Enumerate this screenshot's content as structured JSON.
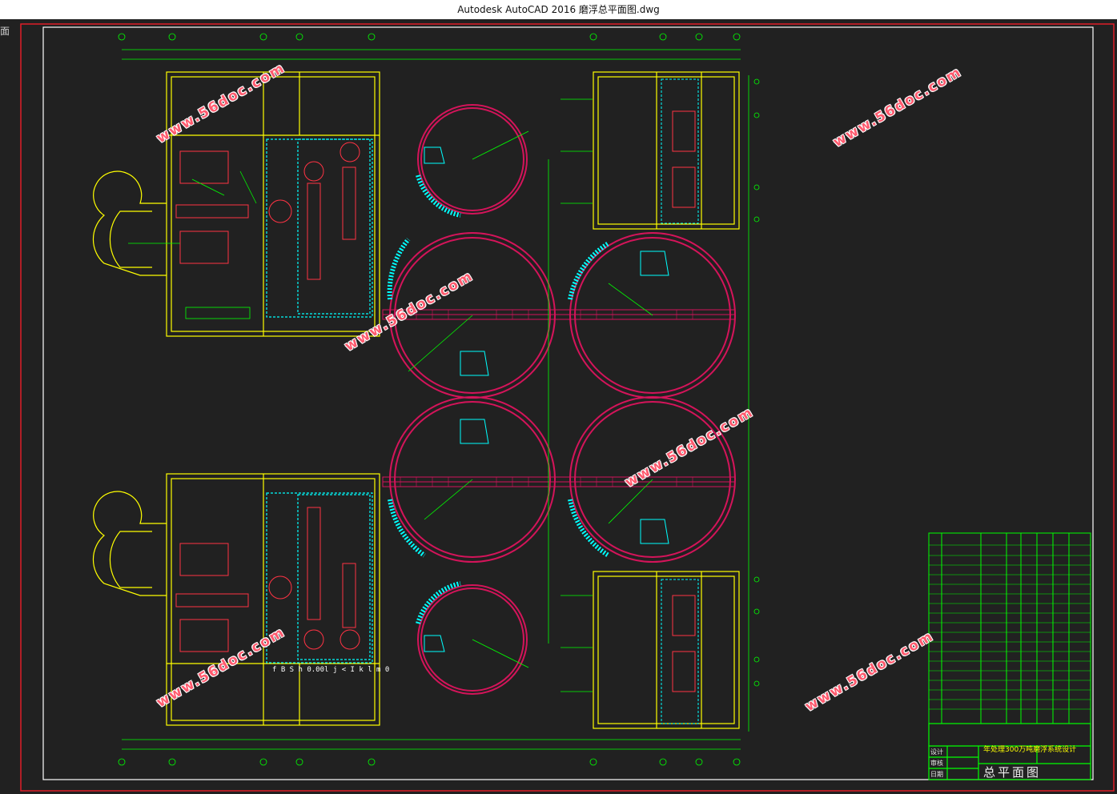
{
  "window": {
    "title": "Autodesk AutoCAD 2016     磨浮总平面图.dwg",
    "viewport_label": "面"
  },
  "drawing": {
    "text_strip": "f B S h  0.00l j < I k l m 0",
    "title_block": {
      "drawing_title": "总平面图",
      "project_name": "年处理300万吨磨浮系统设计",
      "roles": [
        "设计",
        "审核",
        "日期"
      ]
    },
    "watermarks": [
      "www.56doc.com",
      "www.56doc.com",
      "www.56doc.com",
      "www.56doc.com",
      "www.56doc.com",
      "www.56doc.com",
      "www.56doc.com"
    ]
  },
  "colors": {
    "background": "#212121",
    "frame_red": "#e01e28",
    "frame_white": "#ffffff",
    "yellow": "#ffff00",
    "green": "#00ff00",
    "magenta": "#d4145a",
    "cyan": "#00ffff",
    "watermark": "#ff5a6e"
  }
}
